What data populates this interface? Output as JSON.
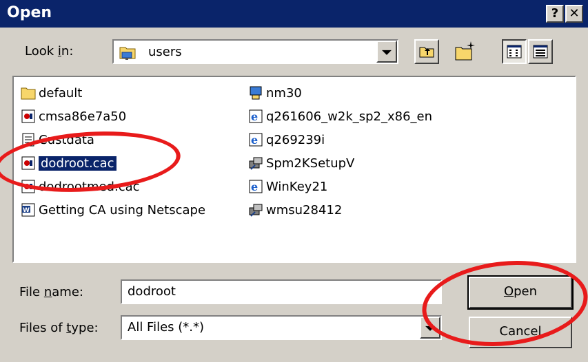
{
  "title": "Open",
  "title_buttons": {
    "help": "?",
    "close": "✕"
  },
  "look_in": {
    "label_pre": "Look ",
    "label_key": "i",
    "label_post": "n:",
    "value": "users"
  },
  "toolbar_icons": [
    "up-folder-icon",
    "new-folder-icon",
    "list-view-icon",
    "details-view-icon"
  ],
  "files_left": [
    {
      "name": "default",
      "icon": "folder-icon"
    },
    {
      "name": "cmsa86e7a50",
      "icon": "cert-file-icon"
    },
    {
      "name": "Custdata",
      "icon": "text-file-icon"
    },
    {
      "name": "dodroot.cac",
      "icon": "cert-file-icon",
      "selected": true
    },
    {
      "name": "dodrootmed.cac",
      "icon": "cert-file-icon"
    },
    {
      "name": "Getting CA using Netscape",
      "icon": "word-doc-icon"
    }
  ],
  "files_right": [
    {
      "name": "nm30",
      "icon": "app-icon"
    },
    {
      "name": "q261606_w2k_sp2_x86_en",
      "icon": "ie-icon"
    },
    {
      "name": "q269239i",
      "icon": "ie-icon"
    },
    {
      "name": "Spm2KSetupV",
      "icon": "installer-icon"
    },
    {
      "name": "WinKey21",
      "icon": "ie-icon"
    },
    {
      "name": "wmsu28412",
      "icon": "installer-icon"
    }
  ],
  "file_name": {
    "label_pre": "File ",
    "label_key": "n",
    "label_post": "ame:",
    "value": "dodroot"
  },
  "file_type": {
    "label_pre": "Files of ",
    "label_key": "t",
    "label_post": "ype:",
    "value": "All Files (*.*)"
  },
  "buttons": {
    "open_key": "O",
    "open_rest": "pen",
    "cancel": "Cancel"
  },
  "annotation_color": "#e81b1b"
}
